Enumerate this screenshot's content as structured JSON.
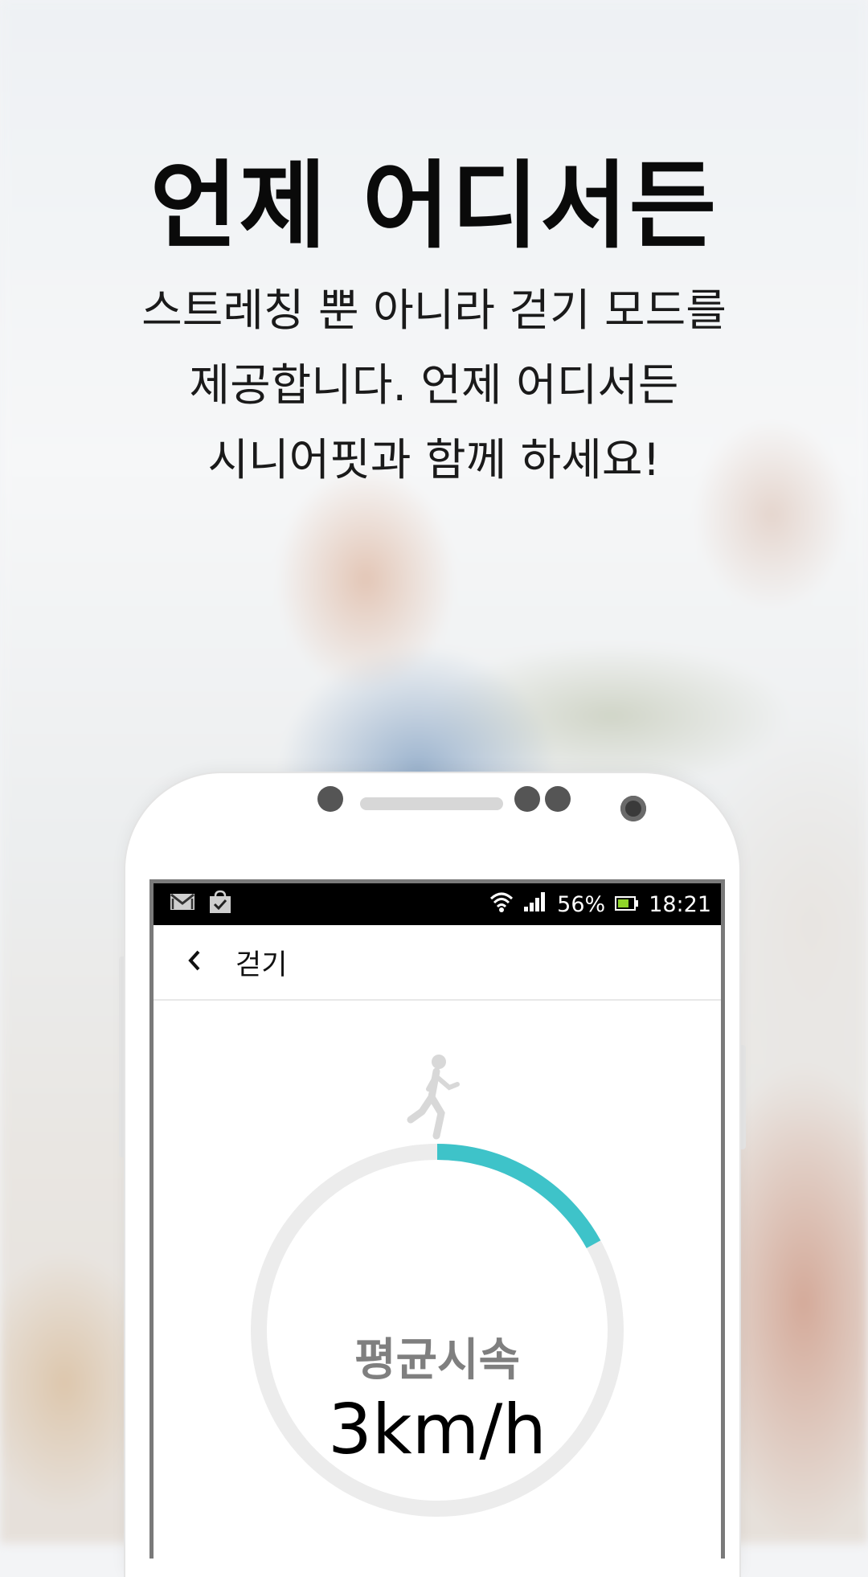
{
  "promo": {
    "headline": "언제 어디서든",
    "lines": [
      "스트레칭 뿐 아니라 걷기 모드를",
      "제공합니다. 언제 어디서든",
      "시니어핏과 함께 하세요!"
    ]
  },
  "status_bar": {
    "left_icons": [
      "mail-icon",
      "shopping-bag-check-icon"
    ],
    "right_icons": [
      "wifi-icon",
      "signal-icon",
      "battery-icon"
    ],
    "battery": "56%",
    "time": "18:21"
  },
  "app_bar": {
    "back_icon": "chevron-left-icon",
    "title": "걷기"
  },
  "walking": {
    "icon": "walking-person-icon",
    "metric_label": "평균시속",
    "metric_value": "3km/h",
    "progress_fraction": 0.17
  },
  "colors": {
    "accent": "#3ec3c9",
    "ring_track": "#ececec",
    "metric_label": "#7f7f7f"
  }
}
